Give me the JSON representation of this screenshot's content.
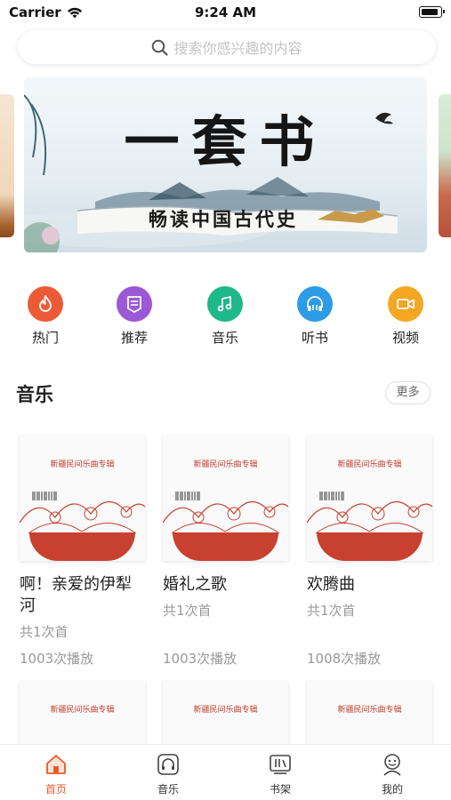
{
  "status_bar": {
    "carrier": "Carrier",
    "time": "9:24 AM"
  },
  "search": {
    "placeholder": "搜索你感兴趣的内容"
  },
  "banner": {
    "title": "一套书",
    "subtitle": "畅读中国古代史"
  },
  "categories": [
    {
      "label": "热门",
      "icon": "flame-icon",
      "color": "#ec5a36"
    },
    {
      "label": "推荐",
      "icon": "recommend-icon",
      "color": "#9b59d6"
    },
    {
      "label": "音乐",
      "icon": "music-note-icon",
      "color": "#1fb889"
    },
    {
      "label": "听书",
      "icon": "headphones-icon",
      "color": "#2d9be6"
    },
    {
      "label": "视频",
      "icon": "video-camera-icon",
      "color": "#f5a623"
    }
  ],
  "section": {
    "title": "音乐",
    "more_label": "更多"
  },
  "albums": [
    {
      "cover_title": "新疆民间乐曲专辑",
      "title": "啊！亲爱的伊犁河",
      "count": "共1次首",
      "plays": "1003次播放"
    },
    {
      "cover_title": "新疆民间乐曲专辑",
      "title": "婚礼之歌",
      "count": "共1次首",
      "plays": "1003次播放"
    },
    {
      "cover_title": "新疆民间乐曲专辑",
      "title": "欢腾曲",
      "count": "共1次首",
      "plays": "1008次播放"
    },
    {
      "cover_title": "新疆民间乐曲专辑"
    },
    {
      "cover_title": "新疆民间乐曲专辑"
    },
    {
      "cover_title": "新疆民间乐曲专辑"
    }
  ],
  "tabs": [
    {
      "label": "首页",
      "icon": "home-icon",
      "active": true
    },
    {
      "label": "音乐",
      "icon": "music-tab-icon",
      "active": false
    },
    {
      "label": "书架",
      "icon": "bookshelf-icon",
      "active": false
    },
    {
      "label": "我的",
      "icon": "profile-icon",
      "active": false
    }
  ],
  "colors": {
    "accent": "#e85a2a",
    "cover_red": "#c8402f",
    "muted_text": "#999999"
  }
}
